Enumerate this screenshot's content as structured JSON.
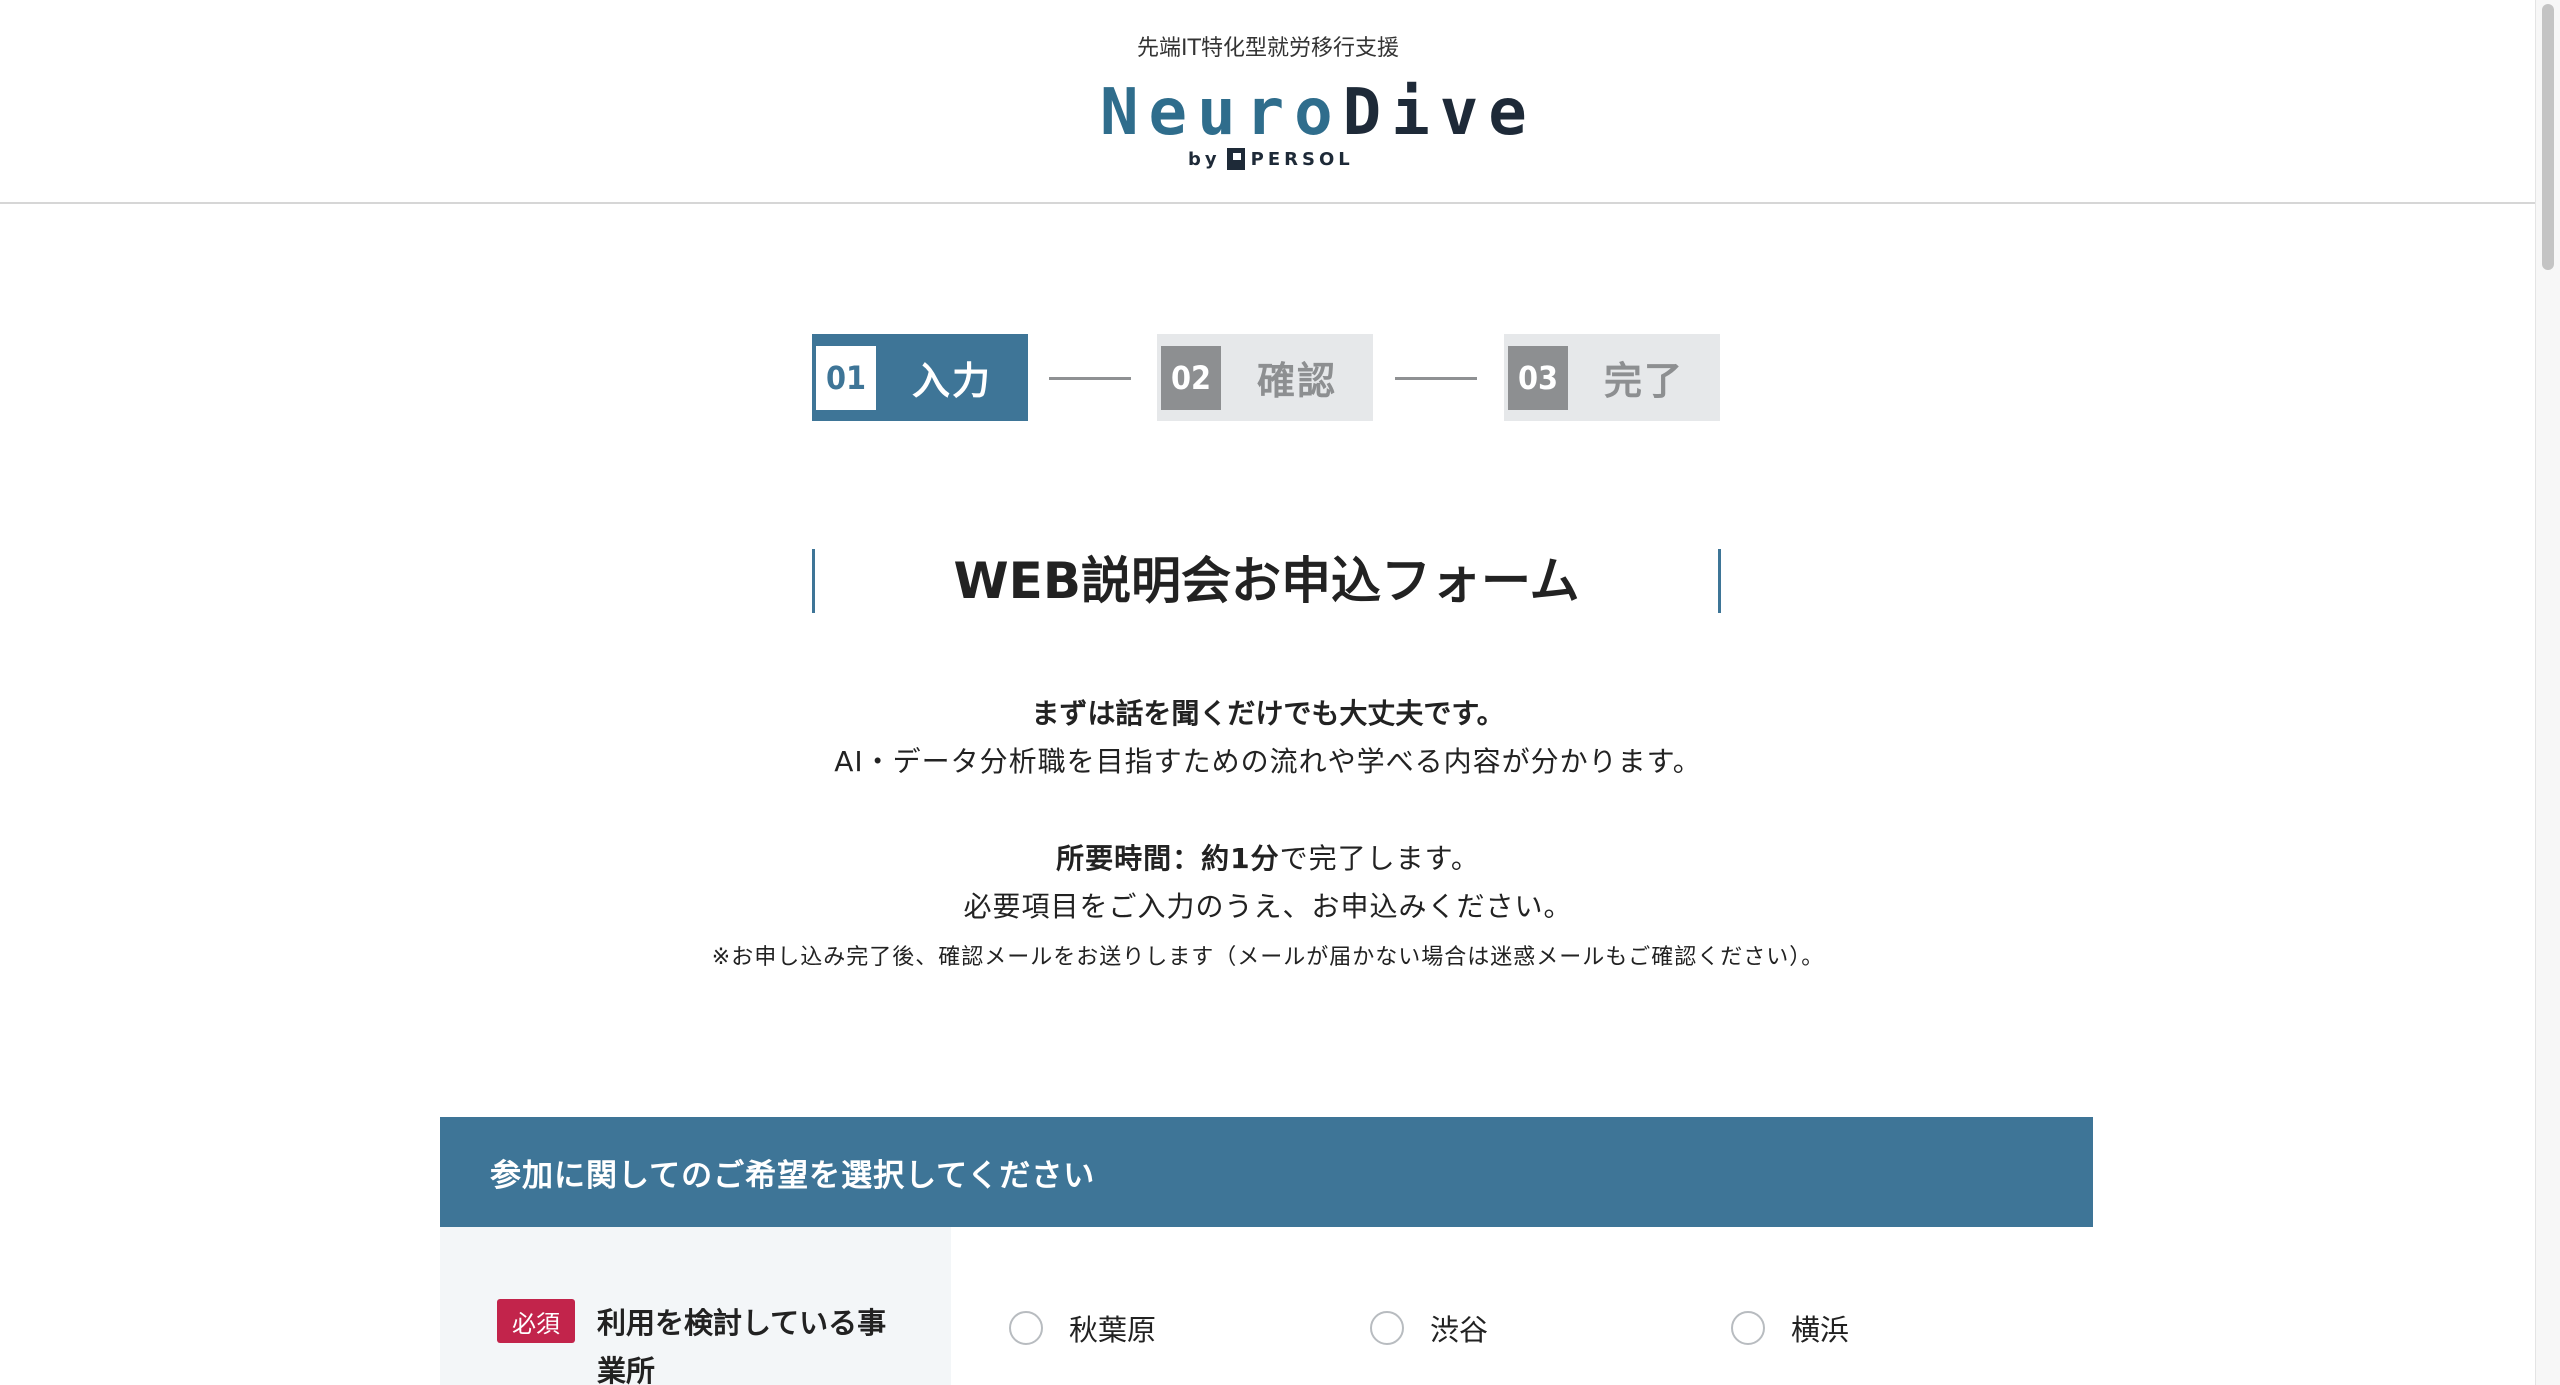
{
  "header": {
    "tagline": "先端IT特化型就労移行支援",
    "logo": {
      "word_neuro": "Neuro",
      "word_dive": "Dive",
      "by": "by",
      "brand": "PERSOL",
      "neuro_color": "#2f6d8c",
      "dive_color": "#1e2a38"
    }
  },
  "stepper": {
    "steps": [
      {
        "num": "01",
        "label": "入力",
        "state": "active"
      },
      {
        "num": "02",
        "label": "確認",
        "state": "inactive"
      },
      {
        "num": "03",
        "label": "完了",
        "state": "inactive"
      }
    ],
    "active_color": "#3e7597",
    "inactive_color": "#e6e8ea"
  },
  "form": {
    "title": "WEB説明会お申込フォーム",
    "intro": {
      "lead": "まずは話を聞くだけでも大丈夫です。",
      "desc": "AI・データ分析職を目指すための流れや学べる内容が分かります。",
      "time_label": "所要時間：約1分",
      "time_suffix": "で完了します。",
      "required": "必要項目をご入力のうえ、お申込みください。",
      "note": "※お申し込み完了後、確認メールをお送りします（メールが届かない場合は迷惑メールもご確認ください）。"
    },
    "section": {
      "title": "参加に関してのご希望を選択してください",
      "color": "#3e7597"
    },
    "office_field": {
      "required_badge": "必須",
      "label": "利用を検討している事業所",
      "badge_color": "#c2244b",
      "options": [
        "秋葉原",
        "渋谷",
        "横浜"
      ]
    }
  }
}
